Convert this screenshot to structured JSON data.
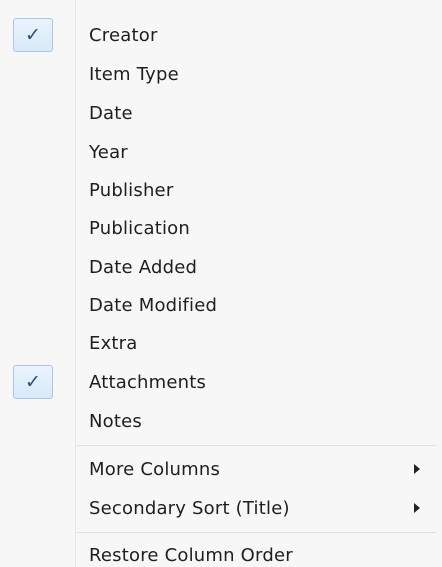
{
  "menu": {
    "items": [
      {
        "label": "Creator",
        "checked": true
      },
      {
        "label": "Item Type",
        "checked": false
      },
      {
        "label": "Date",
        "checked": false
      },
      {
        "label": "Year",
        "checked": false
      },
      {
        "label": "Publisher",
        "checked": false
      },
      {
        "label": "Publication",
        "checked": false
      },
      {
        "label": "Date Added",
        "checked": false
      },
      {
        "label": "Date Modified",
        "checked": false
      },
      {
        "label": "Extra",
        "checked": false
      },
      {
        "label": "Attachments",
        "checked": true
      },
      {
        "label": "Notes",
        "checked": false
      }
    ],
    "submenus": [
      {
        "label": "More Columns",
        "has_submenu": true
      },
      {
        "label": "Secondary Sort (Title)",
        "has_submenu": true
      }
    ],
    "restore_label": "Restore Column Order",
    "check_glyph": "✓"
  }
}
